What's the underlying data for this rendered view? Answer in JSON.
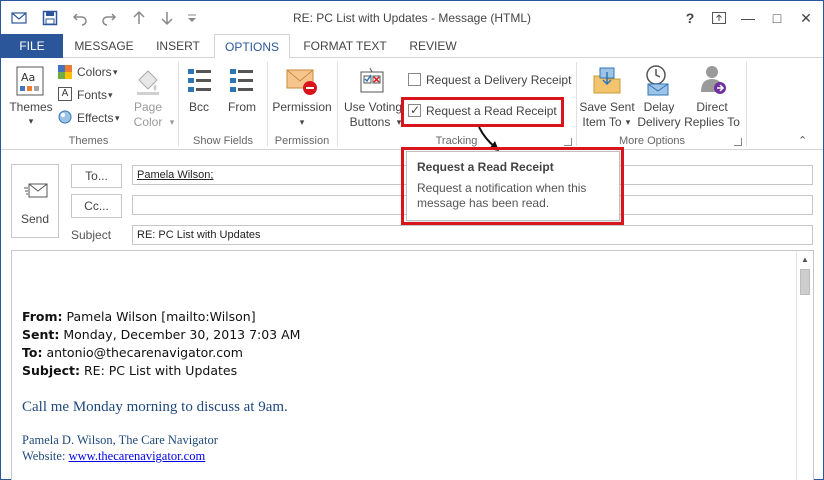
{
  "window": {
    "title": "RE: PC List with Updates - Message (HTML)",
    "help_label": "?",
    "restore_label": "↑",
    "minimize_label": "—",
    "maximize_label": "□",
    "close_label": "✕"
  },
  "tabs": [
    "FILE",
    "MESSAGE",
    "INSERT",
    "OPTIONS",
    "FORMAT TEXT",
    "REVIEW"
  ],
  "ribbon": {
    "themes": {
      "themes_label": "Themes",
      "colors_label": "Colors",
      "fonts_label": "Fonts",
      "effects_label": "Effects",
      "page_label": "Page",
      "color_label": "Color",
      "group_label": "Themes"
    },
    "show_fields": {
      "bcc_label": "Bcc",
      "from_label": "From",
      "group_label": "Show Fields"
    },
    "permission": {
      "label": "Permission",
      "group_label": "Permission"
    },
    "tracking": {
      "voting_label_1": "Use Voting",
      "voting_label_2": "Buttons",
      "delivery_receipt_label": "Request a Delivery Receipt",
      "read_receipt_label": "Request a Read Receipt",
      "group_label": "Tracking"
    },
    "more_options": {
      "save_sent_1": "Save Sent",
      "save_sent_2": "Item To",
      "delay_1": "Delay",
      "delay_2": "Delivery",
      "direct_1": "Direct",
      "direct_2": "Replies To",
      "group_label": "More Options"
    }
  },
  "compose": {
    "send_label": "Send",
    "to_button": "To...",
    "cc_button": "Cc...",
    "subject_label": "Subject",
    "to_value": "Pamela Wilson;",
    "cc_value": "",
    "subject_value": "RE: PC List with Updates"
  },
  "tooltip": {
    "title": "Request a Read Receipt",
    "description": "Request a notification when this message has been read."
  },
  "message": {
    "from_label": "From:",
    "from_value": "Pamela Wilson [mailto:Wilson]",
    "sent_label": "Sent:",
    "sent_value": "Monday, December 30, 2013 7:03 AM",
    "to_label": "To:",
    "to_value": "antonio@thecarenavigator.com",
    "subject_label": "Subject:",
    "subject_value": "RE: PC List with Updates",
    "body_line": "Call me Monday morning to discuss at 9am.",
    "signature_name": "Pamela D. Wilson, The Care Navigator",
    "website_label": "Website:",
    "website_value": "www.thecarenavigator.com"
  },
  "colors": {
    "accent": "#2b579a",
    "highlight": "#d9151c",
    "signature": "#1f497d"
  }
}
